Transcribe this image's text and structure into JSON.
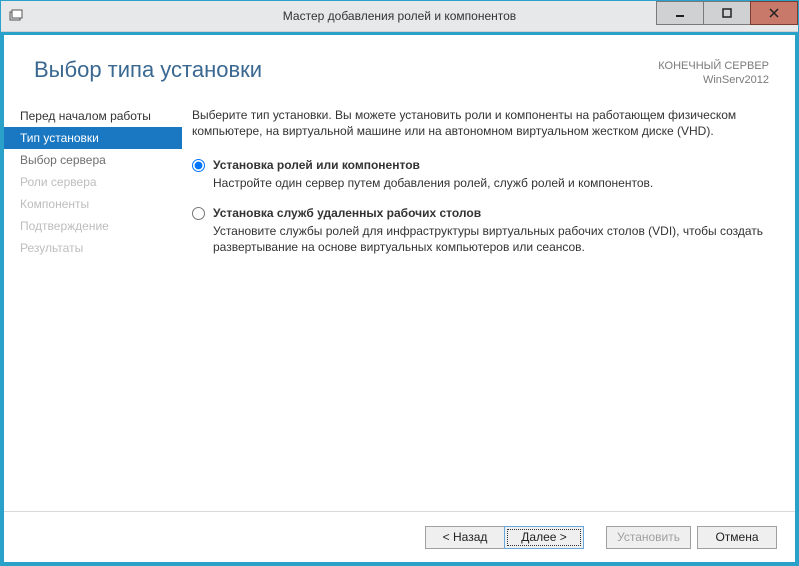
{
  "window": {
    "title": "Мастер добавления ролей и компонентов"
  },
  "header": {
    "page_title": "Выбор типа установки",
    "target_label": "КОНЕЧНЫЙ СЕРВЕР",
    "target_value": "WinServ2012"
  },
  "sidebar": {
    "items": [
      {
        "label": "Перед началом работы",
        "state": "done"
      },
      {
        "label": "Тип установки",
        "state": "active"
      },
      {
        "label": "Выбор сервера",
        "state": "todo"
      },
      {
        "label": "Роли сервера",
        "state": "disabled"
      },
      {
        "label": "Компоненты",
        "state": "disabled"
      },
      {
        "label": "Подтверждение",
        "state": "disabled"
      },
      {
        "label": "Результаты",
        "state": "disabled"
      }
    ]
  },
  "content": {
    "intro": "Выберите тип установки. Вы можете установить роли и компоненты на работающем физическом компьютере, на виртуальной машине или на автономном виртуальном жестком диске (VHD).",
    "options": [
      {
        "title": "Установка ролей или компонентов",
        "desc": "Настройте один сервер путем добавления ролей, служб ролей и компонентов.",
        "selected": true
      },
      {
        "title": "Установка служб удаленных рабочих столов",
        "desc": "Установите службы ролей для инфраструктуры виртуальных рабочих столов (VDI), чтобы создать развертывание на основе виртуальных компьютеров или сеансов.",
        "selected": false
      }
    ]
  },
  "footer": {
    "back": "< Назад",
    "next": "Далее >",
    "install": "Установить",
    "cancel": "Отмена"
  }
}
